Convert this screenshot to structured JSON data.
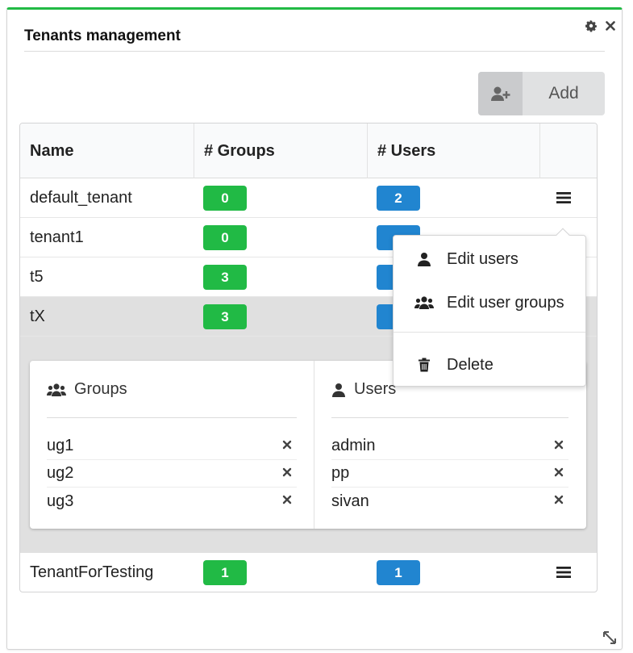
{
  "widget": {
    "title": "Tenants management",
    "accent_color": "#21ba45"
  },
  "toolbar": {
    "add_label": "Add",
    "add_icon": "user-plus-icon"
  },
  "table": {
    "columns": [
      "Name",
      "# Groups",
      "# Users",
      ""
    ],
    "rows": [
      {
        "name": "default_tenant",
        "groups": "0",
        "users": "2"
      },
      {
        "name": "tenant1",
        "groups": "0",
        "users": ""
      },
      {
        "name": "t5",
        "groups": "3",
        "users": ""
      },
      {
        "name": "tX",
        "groups": "3",
        "users": ""
      },
      {
        "name": "TenantForTesting",
        "groups": "1",
        "users": "1"
      }
    ]
  },
  "details": {
    "groups_title": "Groups",
    "groups": [
      "ug1",
      "ug2",
      "ug3"
    ],
    "users_title": "Users",
    "users": [
      "admin",
      "pp",
      "sivan"
    ]
  },
  "menu": {
    "items": [
      "Edit users",
      "Edit user groups",
      "Delete"
    ]
  },
  "colors": {
    "groups_badge": "#21ba45",
    "users_badge": "#2185d0"
  }
}
